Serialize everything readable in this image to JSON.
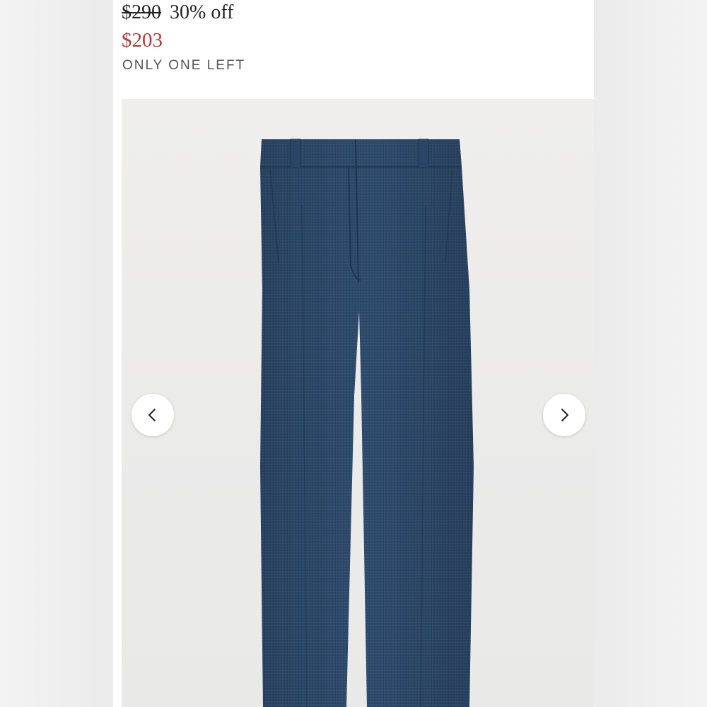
{
  "listing": {
    "original_price": "$290",
    "discount": "30% off",
    "sale_price": "$203",
    "stock_status": "ONLY ONE LEFT"
  },
  "gallery": {
    "prev_icon": "chevron-left-icon",
    "next_icon": "chevron-right-icon"
  },
  "colors": {
    "sale_price": "#b23a3a",
    "product_fabric": "#2e4a6b"
  }
}
